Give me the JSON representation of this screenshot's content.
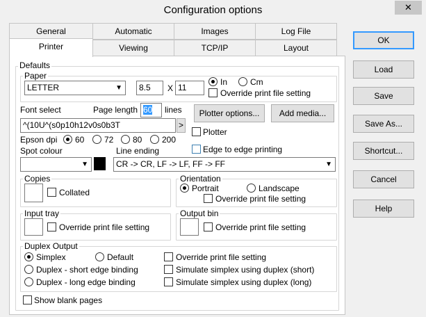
{
  "window": {
    "title": "Configuration options",
    "close": "✕"
  },
  "tabs_back": [
    "General",
    "Automatic",
    "Images",
    "Log File"
  ],
  "tabs_front": [
    "Printer",
    "Viewing",
    "TCP/IP",
    "Layout"
  ],
  "defaults": {
    "label": "Defaults",
    "paper": {
      "label": "Paper",
      "size": "LETTER",
      "width": "8.5",
      "x": "X",
      "height": "11",
      "unit_in": "In",
      "unit_cm": "Cm",
      "override": "Override print file setting"
    },
    "font_select": "Font select",
    "page_length_label": "Page length",
    "page_length_value": "60",
    "lines": "lines",
    "font_string": "^(10U^(s0p10h12v0s0b3T",
    "font_btn": ">",
    "plotter_options": "Plotter options...",
    "add_media": "Add media...",
    "plotter": "Plotter",
    "epson_dpi": "Epson dpi",
    "dpi_options": [
      "60",
      "72",
      "80",
      "200"
    ],
    "edge_to_edge": "Edge to edge printing",
    "spot_colour": "Spot colour",
    "line_ending_label": "Line ending",
    "line_ending_value": "CR -> CR, LF -> LF, FF -> FF",
    "copies": {
      "label": "Copies",
      "collated": "Collated"
    },
    "orientation": {
      "label": "Orientation",
      "portrait": "Portrait",
      "landscape": "Landscape",
      "override": "Override print file setting"
    },
    "input_tray": {
      "label": "Input tray",
      "override": "Override print file setting"
    },
    "output_bin": {
      "label": "Output bin",
      "override": "Override print file setting"
    },
    "duplex": {
      "label": "Duplex Output",
      "simplex": "Simplex",
      "default": "Default",
      "short": "Duplex - short edge binding",
      "long": "Duplex - long edge binding",
      "override": "Override print file setting",
      "sim_short": "Simulate simplex using duplex (short)",
      "sim_long": "Simulate simplex using duplex (long)"
    },
    "show_blank": "Show blank pages"
  },
  "buttons": {
    "ok": "OK",
    "load": "Load",
    "save": "Save",
    "save_as": "Save As...",
    "shortcut": "Shortcut...",
    "cancel": "Cancel",
    "help": "Help"
  },
  "colors": {
    "accent": "#3399ff",
    "highlight": "#3399ff",
    "tab_border": "#c5c5c5"
  }
}
